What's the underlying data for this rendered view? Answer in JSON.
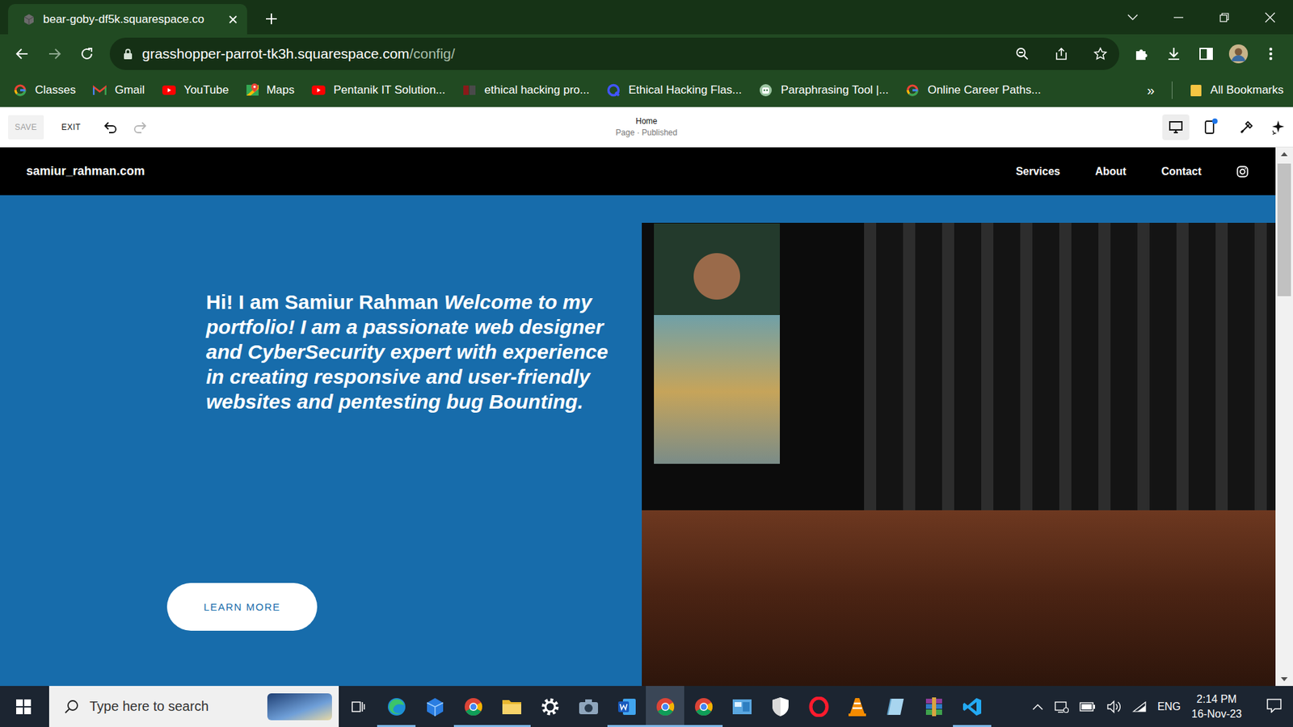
{
  "browser": {
    "tab": {
      "title": "bear-goby-df5k.squarespace.co"
    },
    "url": {
      "host": "grasshopper-parrot-tk3h.squarespace.com",
      "path": "/config/"
    },
    "bookmarks": [
      {
        "label": "Classes",
        "kind": "google"
      },
      {
        "label": "Gmail",
        "kind": "gmail"
      },
      {
        "label": "YouTube",
        "kind": "youtube"
      },
      {
        "label": "Maps",
        "kind": "maps"
      },
      {
        "label": "Pentanik IT Solution...",
        "kind": "youtube"
      },
      {
        "label": "ethical hacking pro...",
        "kind": "pn"
      },
      {
        "label": "Ethical Hacking Flas...",
        "kind": "quizlet"
      },
      {
        "label": "Paraphrasing Tool |...",
        "kind": "bot"
      },
      {
        "label": "Online Career Paths...",
        "kind": "google"
      }
    ],
    "bookmarks_overflow": "»",
    "all_bookmarks": "All Bookmarks"
  },
  "editor": {
    "save": {
      "label": "SAVE",
      "disabled": true
    },
    "exit": "EXIT",
    "page": {
      "title": "Home",
      "status": "Page · Published"
    },
    "devices": [
      {
        "kind": "desktop",
        "selected": true,
        "badge": false
      },
      {
        "kind": "mobile",
        "selected": false,
        "badge": true
      }
    ]
  },
  "site": {
    "brand": "samiur_rahman.com",
    "nav": [
      "Services",
      "About",
      "Contact"
    ],
    "hero": {
      "intro": "Hi! I am Samiur Rahman",
      "message": "Welcome to my portfolio! I am a passionate web designer and CyberSecurity expert with experience in creating responsive and user-friendly websites and pentesting bug Bounting.",
      "button": "LEARN MORE"
    }
  },
  "scrollbar": {
    "level": 0.0
  },
  "taskbar": {
    "search_placeholder": "Type here to search",
    "apps": [
      {
        "kind": "edge",
        "running": true,
        "active": false
      },
      {
        "kind": "cube",
        "running": false,
        "active": false
      },
      {
        "kind": "chrome",
        "running": true,
        "active": false
      },
      {
        "kind": "folder",
        "running": true,
        "active": false
      },
      {
        "kind": "settings",
        "running": false,
        "active": false
      },
      {
        "kind": "camera",
        "running": false,
        "active": false
      },
      {
        "kind": "word",
        "running": true,
        "active": false
      },
      {
        "kind": "chrome",
        "running": true,
        "active": true
      },
      {
        "kind": "chrome",
        "running": true,
        "active": false
      },
      {
        "kind": "panel",
        "running": false,
        "active": false
      },
      {
        "kind": "shield",
        "running": false,
        "active": false
      },
      {
        "kind": "opera",
        "running": false,
        "active": false
      },
      {
        "kind": "vlc",
        "running": false,
        "active": false
      },
      {
        "kind": "glass",
        "running": false,
        "active": false
      },
      {
        "kind": "winrar",
        "running": false,
        "active": false
      },
      {
        "kind": "vscode",
        "running": true,
        "active": false
      }
    ],
    "language": "ENG",
    "time": "2:14 PM",
    "date": "16-Nov-23"
  }
}
